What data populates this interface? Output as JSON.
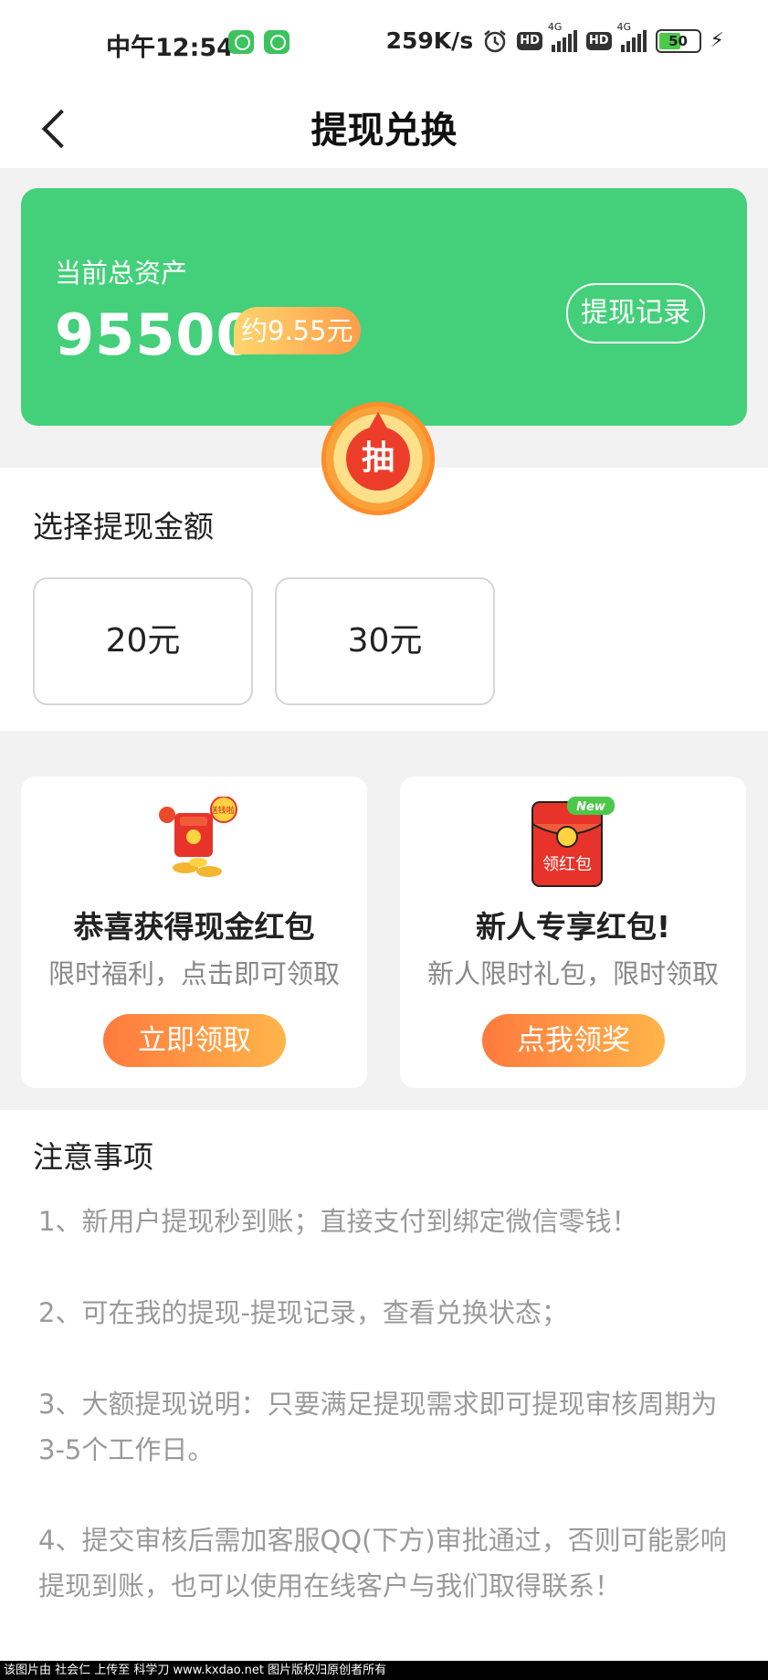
{
  "status_bar": {
    "time": "中午12:54",
    "network_speed": "259K/s",
    "hd_label": "HD",
    "signal_label": "4G",
    "battery": "50",
    "icons": [
      "app-notification-icon",
      "app-notification-icon",
      "alarm-icon",
      "hd-icon",
      "signal-icon",
      "battery-icon",
      "charging-icon"
    ]
  },
  "header": {
    "title": "提现兑换",
    "back_icon": "chevron-left-icon"
  },
  "asset": {
    "label": "当前总资产",
    "value": "95500",
    "approx": "约9.55元",
    "record_button": "提现记录"
  },
  "lottery": {
    "label": "抽"
  },
  "withdraw": {
    "title": "选择提现金额",
    "options": [
      "20元",
      "30元"
    ]
  },
  "rewards": [
    {
      "icon": "money-bag-icon",
      "icon_text": "送钱啦!",
      "title": "恭喜获得现金红包",
      "desc": "限时福利，点击即可领取",
      "button": "立即领取"
    },
    {
      "icon": "red-packet-icon",
      "icon_text": "领红包",
      "badge": "New",
      "title": "新人专享红包!",
      "desc": "新人限时礼包，限时领取",
      "button": "点我领奖"
    }
  ],
  "notes": {
    "title": "注意事项",
    "items": [
      "1、新用户提现秒到账；直接支付到绑定微信零钱！",
      "2、可在我的提现-提现记录，查看兑换状态；",
      "3、大额提现说明：只要满足提现需求即可提现审核周期为3-5个工作日。",
      "4、提交审核后需加客服QQ(下方)审批通过，否则可能影响提现到账，也可以使用在线客户与我们取得联系！"
    ]
  },
  "footer": {
    "watermark": "该图片由 社会仁 上传至 科学刀 www.kxdao.net 图片版权归原创者所有"
  },
  "colors": {
    "brand_green": "#44d07a",
    "accent_orange": "#ff8d3a",
    "lottery_red": "#ec3d2b"
  }
}
